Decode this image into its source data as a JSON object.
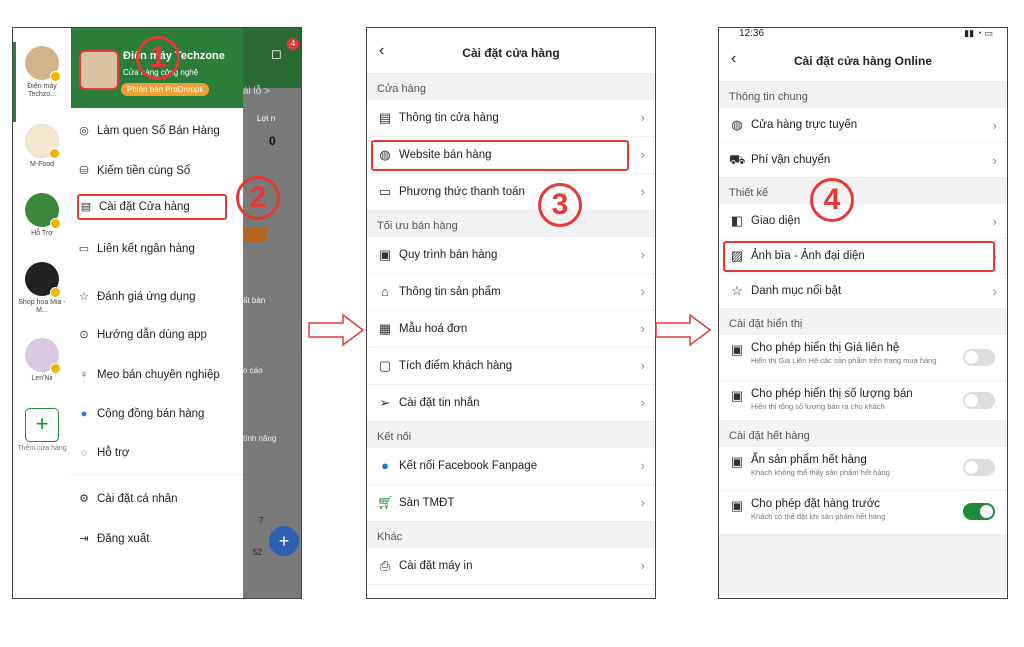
{
  "phone1": {
    "rail": [
      {
        "label": "Điện máy Techzo..."
      },
      {
        "label": "M-Food"
      },
      {
        "label": "Hỗ Trợ"
      },
      {
        "label": "Shop hoa Mia - M..."
      },
      {
        "label": "Len'Nii"
      },
      {
        "label": "Thêm cửa hàng"
      }
    ],
    "store_name": "Điện máy Techzone",
    "store_sub": "Cửa hàng công nghệ",
    "pill": "Phiên bản ProDroppii",
    "menu": [
      "Làm quen Sổ Bán Hàng",
      "Kiếm tiền cùng Sổ",
      "Cài đặt Cửa hàng",
      "Liên kết ngân hàng",
      "Đánh giá ứng dụng",
      "Hướng dẫn dùng app",
      "Mẹo bán chuyên nghiệp",
      "Cộng đồng bán hàng",
      "Hỗ trợ",
      "Cài đặt cá nhân",
      "Đăng xuất"
    ],
    "overlay": {
      "chip": "ài lỗ >",
      "profit": "Lợi n",
      "zero": "0",
      "b1": "ất bán",
      "b2": "o cáo",
      "b3": "tính năng",
      "notif": "4",
      "n1": "7",
      "n2": "52"
    }
  },
  "phone2": {
    "title": "Cài đặt cửa hàng",
    "sections": [
      {
        "name": "Cửa hàng",
        "rows": [
          "Thông tin cửa hàng",
          "Website bán hàng",
          "Phương thức thanh toán"
        ]
      },
      {
        "name": "Tối ưu bán hàng",
        "rows": [
          "Quy trình bán hàng",
          "Thông tin sản phẩm",
          "Mẫu hoá đơn",
          "Tích điểm khách hàng",
          "Cài đặt tin nhắn"
        ]
      },
      {
        "name": "Kết nối",
        "rows": [
          "Kết nối Facebook Fanpage",
          "Sàn TMĐT"
        ]
      },
      {
        "name": "Khác",
        "rows": [
          "Cài đặt máy in"
        ]
      }
    ]
  },
  "phone3": {
    "time": "12:36",
    "title": "Cài đặt cửa hàng Online",
    "sec1": "Thông tin chung",
    "r1": "Cửa hàng trực tuyến",
    "r2": "Phí vận chuyển",
    "sec2": "Thiết kế",
    "r3": "Giao diện",
    "r4": "Ảnh bìa - Ảnh đại diện",
    "r5": "Danh mục nổi bật",
    "sec3": "Cài đặt hiển thị",
    "t1": "Cho phép hiển thị Giá liên hệ",
    "t1s": "Hiển thị Giá Liên Hệ các sản phẩm trên trang mua hàng",
    "t2": "Cho phép hiển thị số lượng bán",
    "t2s": "Hiển thị tổng số lượng bán ra cho khách",
    "sec4": "Cài đặt hết hàng",
    "t3": "Ẩn sản phẩm hết hàng",
    "t3s": "Khách không thể thấy sản phẩm hết hàng",
    "t4": "Cho phép đặt hàng trước",
    "t4s": "Khách có thể đặt khi sản phẩm hết hàng"
  },
  "steps": [
    "1",
    "2",
    "3",
    "4"
  ],
  "colors": {
    "brand": "#2a7e3a",
    "accent": "#e53935",
    "toggle_on": "#1c8c3a"
  }
}
